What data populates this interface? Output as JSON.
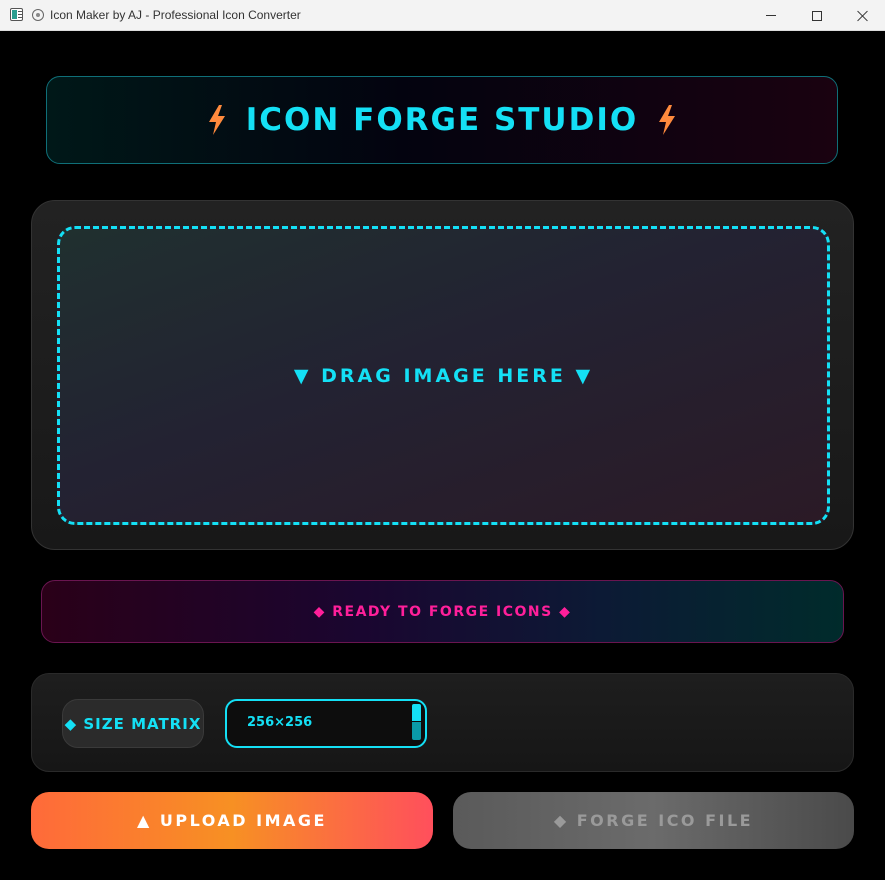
{
  "window": {
    "title": "Icon Maker by AJ - Professional Icon Converter",
    "icons": [
      "app-icon",
      "palette-icon",
      "minimize-icon",
      "maximize-icon",
      "close-icon"
    ]
  },
  "header": {
    "title": "ICON FORGE STUDIO",
    "icon": "lightning-bolt-icon",
    "icon_color": "#ff8a3d"
  },
  "dropzone": {
    "label": "▼ DRAG IMAGE HERE ▼"
  },
  "status": {
    "text": "◆ READY TO FORGE ICONS ◆"
  },
  "size": {
    "label": "◆ SIZE MATRIX",
    "selected": "256×256"
  },
  "actions": {
    "upload_label": "▲ UPLOAD IMAGE",
    "forge_label": "◆ FORGE ICO FILE"
  },
  "colors": {
    "accent_cyan": "#14e0f5",
    "accent_pink": "#ff1f9a",
    "accent_orange": "#f79023",
    "disabled_gray": "#6b6b6b"
  }
}
